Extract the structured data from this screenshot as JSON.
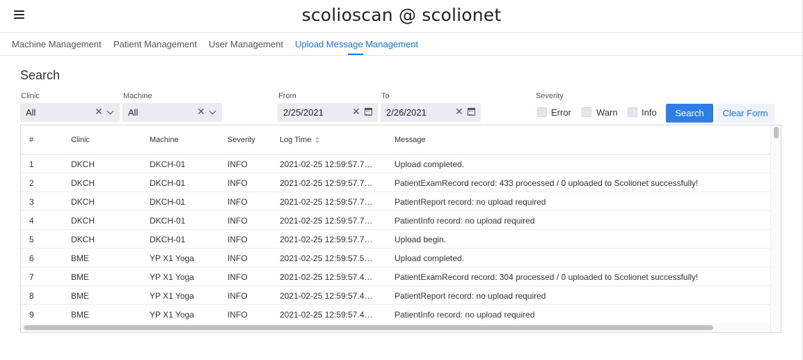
{
  "app": {
    "title": "scolioscan @ scolionet"
  },
  "nav": {
    "tabs": [
      {
        "label": "Machine Management",
        "active": false
      },
      {
        "label": "Patient Management",
        "active": false
      },
      {
        "label": "User Management",
        "active": false
      },
      {
        "label": "Upload Message Management",
        "active": true
      }
    ]
  },
  "search": {
    "title": "Search",
    "clinic": {
      "label": "Clinic",
      "value": "All"
    },
    "machine": {
      "label": "Machine",
      "value": "All"
    },
    "from": {
      "label": "From",
      "value": "2/25/2021"
    },
    "to": {
      "label": "To",
      "value": "2/26/2021"
    },
    "severity": {
      "label": "Severity",
      "options": [
        {
          "label": "Error",
          "checked": false
        },
        {
          "label": "Warn",
          "checked": false
        },
        {
          "label": "Info",
          "checked": false
        }
      ]
    },
    "search_button": "Search",
    "clear_button": "Clear Form"
  },
  "table": {
    "columns": [
      "#",
      "Clinic",
      "Machine",
      "Severity",
      "Log Time",
      "Message"
    ],
    "rows": [
      [
        "1",
        "DKCH",
        "DKCH-01",
        "INFO",
        "2021-02-25 12:59:57.7…",
        "Upload completed."
      ],
      [
        "2",
        "DKCH",
        "DKCH-01",
        "INFO",
        "2021-02-25 12:59:57.7…",
        "PatientExamRecord record: 433 processed / 0 uploaded to Scolionet successfully!"
      ],
      [
        "3",
        "DKCH",
        "DKCH-01",
        "INFO",
        "2021-02-25 12:59:57.7…",
        "PatientReport record: no upload required"
      ],
      [
        "4",
        "DKCH",
        "DKCH-01",
        "INFO",
        "2021-02-25 12:59:57.7…",
        "PatientInfo record: no upload required"
      ],
      [
        "5",
        "DKCH",
        "DKCH-01",
        "INFO",
        "2021-02-25 12:59:57.7…",
        "Upload begin."
      ],
      [
        "6",
        "BME",
        "YP X1 Yoga",
        "INFO",
        "2021-02-25 12:59:57.5…",
        "Upload completed."
      ],
      [
        "7",
        "BME",
        "YP X1 Yoga",
        "INFO",
        "2021-02-25 12:59:57.4…",
        "PatientExamRecord record: 304 processed / 0 uploaded to Scolionet successfully!"
      ],
      [
        "8",
        "BME",
        "YP X1 Yoga",
        "INFO",
        "2021-02-25 12:59:57.4…",
        "PatientReport record: no upload required"
      ],
      [
        "9",
        "BME",
        "YP X1 Yoga",
        "INFO",
        "2021-02-25 12:59:57.4…",
        "PatientInfo record: no upload required"
      ]
    ]
  },
  "colors": {
    "accent": "#1a73e8",
    "primary_button": "#2d7ee6",
    "input_bg": "#e9ecf1"
  }
}
